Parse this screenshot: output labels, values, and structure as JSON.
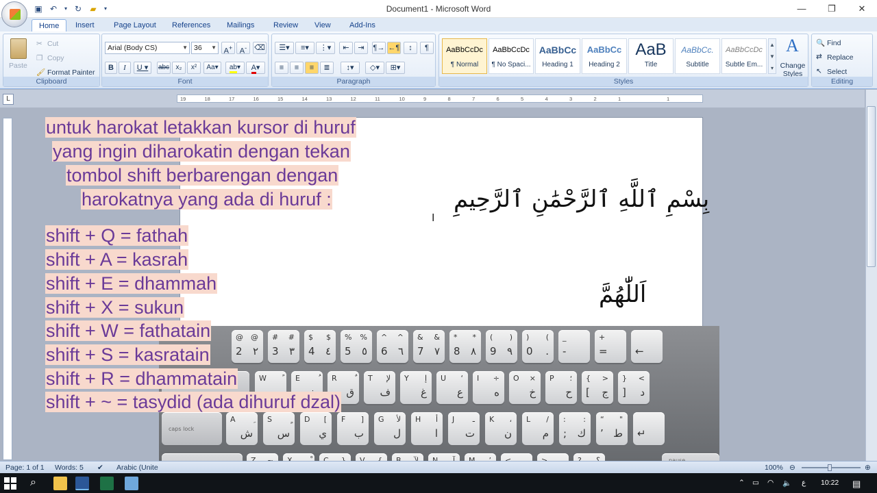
{
  "window": {
    "title": "Document1 - Microsoft Word"
  },
  "qat": {
    "icons": [
      "save-icon",
      "undo-icon",
      "redo-icon",
      "open-icon",
      "customize-icon"
    ]
  },
  "tabs": [
    "Home",
    "Insert",
    "Page Layout",
    "References",
    "Mailings",
    "Review",
    "View",
    "Add-Ins"
  ],
  "ribbon": {
    "clipboard": {
      "paste": "Paste",
      "cut": "Cut",
      "copy": "Copy",
      "format_painter": "Format Painter",
      "label": "Clipboard"
    },
    "font": {
      "family": "Arial (Body CS)",
      "size": "36",
      "label": "Font"
    },
    "paragraph": {
      "label": "Paragraph"
    },
    "styles": {
      "label": "Styles",
      "items": [
        {
          "sample": "AaBbCcDc",
          "name": "¶ Normal"
        },
        {
          "sample": "AaBbCcDc",
          "name": "¶ No Spaci..."
        },
        {
          "sample": "AaBbCc",
          "name": "Heading 1"
        },
        {
          "sample": "AaBbCc",
          "name": "Heading 2"
        },
        {
          "sample": "AaB",
          "name": "Title"
        },
        {
          "sample": "AaBbCc.",
          "name": "Subtitle"
        },
        {
          "sample": "AaBbCcDc",
          "name": "Subtle Em..."
        }
      ],
      "change_styles": "Change Styles"
    },
    "editing": {
      "find": "Find",
      "replace": "Replace",
      "select": "Select",
      "label": "Editing"
    }
  },
  "ruler": {
    "ticks": [
      "19",
      "18",
      "17",
      "16",
      "15",
      "14",
      "13",
      "12",
      "11",
      "10",
      "9",
      "8",
      "7",
      "6",
      "5",
      "4",
      "3",
      "2",
      "1",
      "",
      "1"
    ]
  },
  "document": {
    "intro_lines": [
      "untuk harokat letakkan kursor di huruf",
      "yang ingin diharokatin dengan tekan",
      "tombol shift berbarengan dengan",
      "harokatnya yang ada di huruf :"
    ],
    "shortcuts": [
      "shift + Q = fathah",
      "shift + A = kasrah",
      "shift + E = dhammah",
      "shift + X = sukun",
      "shift + W = fathatain",
      "shift + S = kasratain",
      "shift + R = dhammatain",
      "shift + ~ = tasydid (ada dihuruf dzal)"
    ],
    "arabic_line1": "بِسْمِ ٱللَّهِ ٱلرَّحْمَٰنِ ٱلرَّحِيمِ",
    "arabic_line2": "اَللّٰهُمَّ"
  },
  "keyboard": {
    "row1": [
      {
        "tl": "@",
        "bl": "2",
        "tr": "@",
        "br": "٢"
      },
      {
        "tl": "#",
        "bl": "3",
        "tr": "#",
        "br": "٣"
      },
      {
        "tl": "$",
        "bl": "4",
        "tr": "$",
        "br": "٤"
      },
      {
        "tl": "%",
        "bl": "5",
        "tr": "%",
        "br": "٥"
      },
      {
        "tl": "^",
        "bl": "6",
        "tr": "^",
        "br": "٦"
      },
      {
        "tl": "&",
        "bl": "7",
        "tr": "&",
        "br": "٧"
      },
      {
        "tl": "*",
        "bl": "8",
        "tr": "*",
        "br": "٨"
      },
      {
        "tl": "(",
        "bl": "9",
        "tr": ")",
        "br": "٩"
      },
      {
        "tl": ")",
        "bl": "0",
        "tr": "(",
        "br": "."
      },
      {
        "tl": "_",
        "bl": "-",
        "tr": "",
        "br": ""
      },
      {
        "tl": "+",
        "bl": "=",
        "tr": "",
        "br": ""
      },
      {
        "tl": "",
        "bl": "←",
        "tr": "",
        "br": ""
      }
    ],
    "row2": [
      {
        "tl": "W",
        "bl": "",
        "tr": "ً",
        "br": "ص"
      },
      {
        "tl": "E",
        "bl": "",
        "tr": "ُ",
        "br": "ث"
      },
      {
        "tl": "R",
        "bl": "",
        "tr": "ٌ",
        "br": "ق"
      },
      {
        "tl": "T",
        "bl": "",
        "tr": "لإ",
        "br": "ف"
      },
      {
        "tl": "Y",
        "bl": "",
        "tr": "إ",
        "br": "غ"
      },
      {
        "tl": "U",
        "bl": "",
        "tr": "‘",
        "br": "ع"
      },
      {
        "tl": "I",
        "bl": "",
        "tr": "÷",
        "br": "ه"
      },
      {
        "tl": "O",
        "bl": "",
        "tr": "×",
        "br": "خ"
      },
      {
        "tl": "P",
        "bl": "",
        "tr": "؛",
        "br": "ح"
      },
      {
        "tl": "{",
        "bl": "[",
        "tr": ">",
        "br": "ج"
      },
      {
        "tl": "}",
        "bl": "]",
        "tr": "<",
        "br": "د"
      }
    ],
    "row3": [
      {
        "tl": "A",
        "bl": "",
        "tr": "ِ",
        "br": "ش"
      },
      {
        "tl": "S",
        "bl": "",
        "tr": "ٍ",
        "br": "س"
      },
      {
        "tl": "D",
        "bl": "",
        "tr": "[",
        "br": "ي"
      },
      {
        "tl": "F",
        "bl": "",
        "tr": "]",
        "br": "ب"
      },
      {
        "tl": "G",
        "bl": "",
        "tr": "لأ",
        "br": "ل"
      },
      {
        "tl": "H",
        "bl": "",
        "tr": "أ",
        "br": "ا"
      },
      {
        "tl": "J",
        "bl": "",
        "tr": "ـ",
        "br": "ت"
      },
      {
        "tl": "K",
        "bl": "",
        "tr": "،",
        "br": "ن"
      },
      {
        "tl": "L",
        "bl": "",
        "tr": "/",
        "br": "م"
      },
      {
        "tl": ":",
        "bl": ";",
        "tr": ":",
        "br": "ك"
      },
      {
        "tl": "“",
        "bl": "’",
        "tr": "\"",
        "br": "ط"
      },
      {
        "tl": "",
        "bl": "↵",
        "tr": "",
        "br": ""
      }
    ],
    "row4": [
      {
        "tl": "Z",
        "bl": "",
        "tr": "~",
        "br": "ئ"
      },
      {
        "tl": "X",
        "bl": "",
        "tr": "ْ",
        "br": "ء"
      },
      {
        "tl": "C",
        "bl": "",
        "tr": "}",
        "br": "ؤ"
      },
      {
        "tl": "V",
        "bl": "",
        "tr": "{",
        "br": "ر"
      },
      {
        "tl": "B",
        "bl": "",
        "tr": "لآ",
        "br": "لا"
      },
      {
        "tl": "N",
        "bl": "",
        "tr": "آ",
        "br": "ى"
      },
      {
        "tl": "M",
        "bl": "",
        "tr": "’",
        "br": "ة"
      },
      {
        "tl": "<",
        "bl": ",",
        "tr": ",",
        "br": "و"
      },
      {
        "tl": ">",
        "bl": ".",
        "tr": ".",
        "br": "ز"
      },
      {
        "tl": "?",
        "bl": "/",
        "tr": "؟",
        "br": "ظ"
      }
    ],
    "caps_label": "caps lock",
    "shift_label": "shift ⇧",
    "pause_label": "pause"
  },
  "status": {
    "page": "Page: 1 of 1",
    "words": "Words: 5",
    "language": "Arabic (Unite",
    "zoom": "100%"
  },
  "taskbar": {
    "ime": "ع",
    "time": "10:22"
  }
}
